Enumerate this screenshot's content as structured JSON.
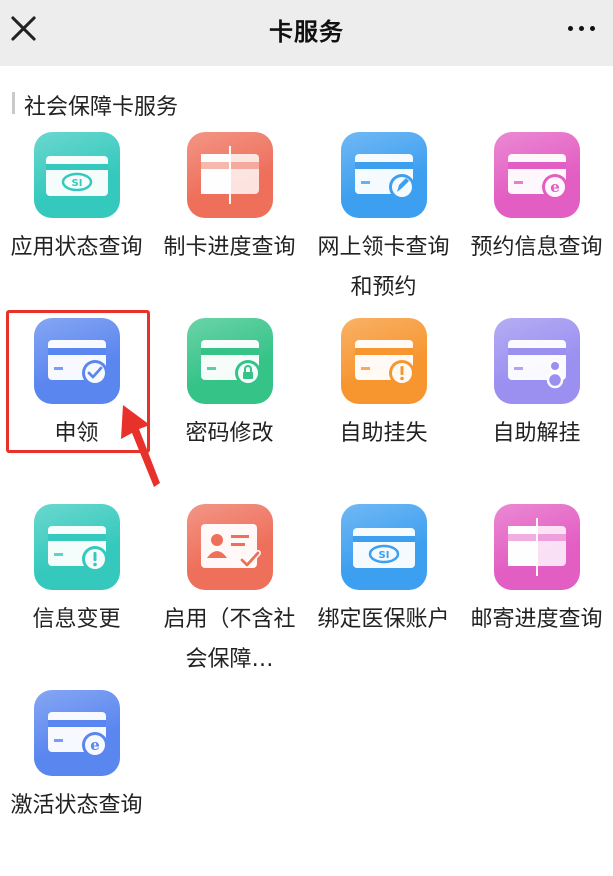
{
  "header": {
    "title": "卡服务",
    "close_icon": "close-icon",
    "more_icon": "more-icon"
  },
  "section": {
    "title": "社会保障卡服务"
  },
  "highlight_color": "#e8312a",
  "tiles": [
    {
      "label": "应用状态查询",
      "icon": "si-card-icon",
      "color": "#35c9bd"
    },
    {
      "label": "制卡进度查询",
      "icon": "card-progress-icon",
      "color": "#ee6f5a"
    },
    {
      "label": "网上领卡查询和预约",
      "icon": "card-edit-icon",
      "color": "#3d9ff0"
    },
    {
      "label": "预约信息查询",
      "icon": "card-e-icon",
      "color": "#e35ec3"
    },
    {
      "label": "申领",
      "icon": "card-check-icon",
      "color": "#5a86ef"
    },
    {
      "label": "密码修改",
      "icon": "card-lock-icon",
      "color": "#35c388"
    },
    {
      "label": "自助挂失",
      "icon": "card-alert-icon",
      "color": "#f7952f"
    },
    {
      "label": "自助解挂",
      "icon": "card-key-icon",
      "color": "#9b8ff0"
    },
    {
      "label": "信息变更",
      "icon": "card-alert-icon",
      "color": "#35c9bd"
    },
    {
      "label": "启用（不含社会保障…",
      "icon": "id-card-check-icon",
      "color": "#ee6f5a"
    },
    {
      "label": "绑定医保账户",
      "icon": "si-card-icon",
      "color": "#3d9ff0"
    },
    {
      "label": "邮寄进度查询",
      "icon": "card-progress-icon",
      "color": "#e35ec3"
    },
    {
      "label": "激活状态查询",
      "icon": "card-e-icon",
      "color": "#5a86ef"
    }
  ]
}
